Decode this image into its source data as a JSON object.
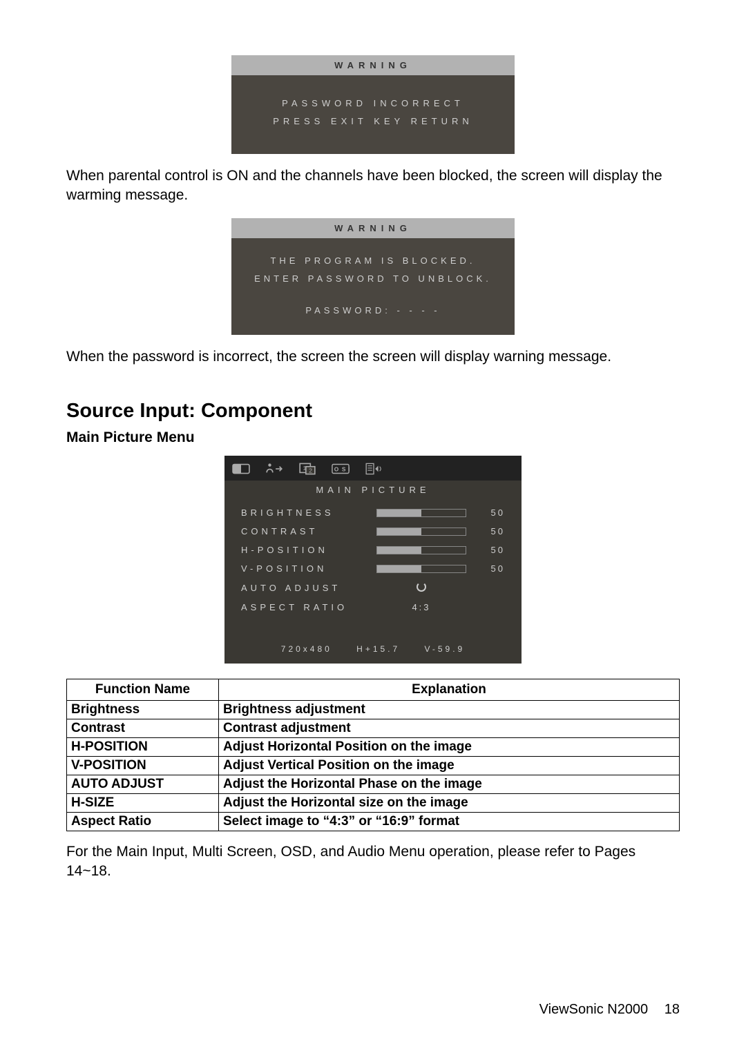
{
  "osd1": {
    "header": "WARNING",
    "line1": "PASSWORD INCORRECT",
    "line2": "PRESS EXIT KEY RETURN"
  },
  "para1": "When parental control is ON and the channels have been blocked, the screen will display the warming message.",
  "osd2": {
    "header": "WARNING",
    "line1": "THE PROGRAM IS BLOCKED.",
    "line2": "ENTER PASSWORD TO UNBLOCK.",
    "line3": "PASSWORD: - - - -"
  },
  "para2": "When the password is incorrect, the screen the screen will display warning message.",
  "section_title": "Source Input: Component",
  "subsection_title": "Main Picture Menu",
  "mp": {
    "title": "MAIN PICTURE",
    "rows": {
      "brightness": {
        "label": "BRIGHTNESS",
        "value": "50"
      },
      "contrast": {
        "label": "CONTRAST",
        "value": "50"
      },
      "hpos": {
        "label": "H-POSITION",
        "value": "50"
      },
      "vpos": {
        "label": "V-POSITION",
        "value": "50"
      },
      "auto": {
        "label": "AUTO ADJUST"
      },
      "aspect": {
        "label": "ASPECT RATIO",
        "value": "4:3"
      }
    },
    "status": "720x480 H+15.7 V-59.9"
  },
  "table": {
    "h1": "Function Name",
    "h2": "Explanation",
    "rows": [
      {
        "name": "Brightness",
        "desc": "Brightness adjustment"
      },
      {
        "name": "Contrast",
        "desc": "Contrast adjustment"
      },
      {
        "name": "H-POSITION",
        "desc": "Adjust Horizontal Position on the image"
      },
      {
        "name": "V-POSITION",
        "desc": "Adjust Vertical Position on the image"
      },
      {
        "name": "AUTO ADJUST",
        "desc": "Adjust the Horizontal Phase on the image"
      },
      {
        "name": "H-SIZE",
        "desc": "Adjust the Horizontal size on the image"
      },
      {
        "name": "Aspect Ratio",
        "desc": "Select image to “4:3” or “16:9” format"
      }
    ]
  },
  "para3": "For the Main Input, Multi Screen, OSD, and Audio Menu operation, please refer to Pages 14~18.",
  "footer": {
    "brand": "ViewSonic  N2000",
    "page": "18"
  }
}
